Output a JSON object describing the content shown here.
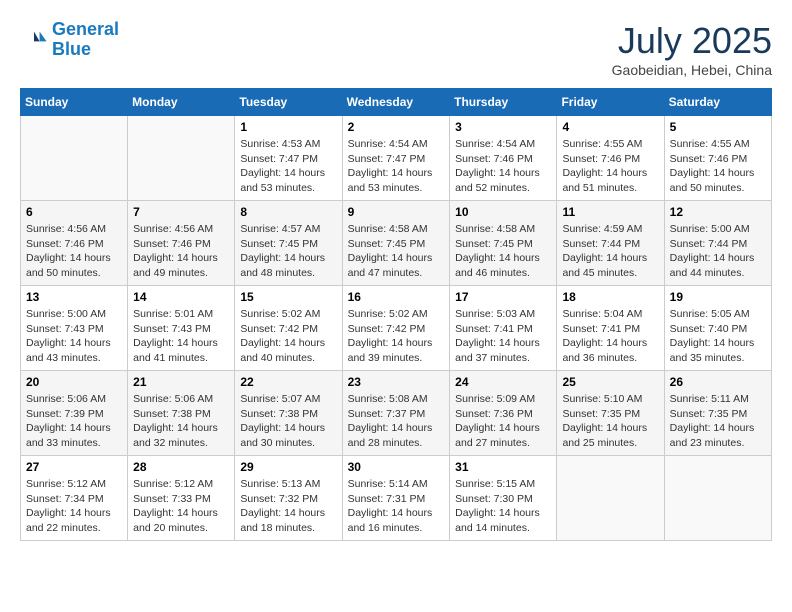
{
  "header": {
    "logo_line1": "General",
    "logo_line2": "Blue",
    "month": "July 2025",
    "location": "Gaobeidian, Hebei, China"
  },
  "days_of_week": [
    "Sunday",
    "Monday",
    "Tuesday",
    "Wednesday",
    "Thursday",
    "Friday",
    "Saturday"
  ],
  "weeks": [
    [
      {
        "num": "",
        "info": ""
      },
      {
        "num": "",
        "info": ""
      },
      {
        "num": "1",
        "info": "Sunrise: 4:53 AM\nSunset: 7:47 PM\nDaylight: 14 hours and 53 minutes."
      },
      {
        "num": "2",
        "info": "Sunrise: 4:54 AM\nSunset: 7:47 PM\nDaylight: 14 hours and 53 minutes."
      },
      {
        "num": "3",
        "info": "Sunrise: 4:54 AM\nSunset: 7:46 PM\nDaylight: 14 hours and 52 minutes."
      },
      {
        "num": "4",
        "info": "Sunrise: 4:55 AM\nSunset: 7:46 PM\nDaylight: 14 hours and 51 minutes."
      },
      {
        "num": "5",
        "info": "Sunrise: 4:55 AM\nSunset: 7:46 PM\nDaylight: 14 hours and 50 minutes."
      }
    ],
    [
      {
        "num": "6",
        "info": "Sunrise: 4:56 AM\nSunset: 7:46 PM\nDaylight: 14 hours and 50 minutes."
      },
      {
        "num": "7",
        "info": "Sunrise: 4:56 AM\nSunset: 7:46 PM\nDaylight: 14 hours and 49 minutes."
      },
      {
        "num": "8",
        "info": "Sunrise: 4:57 AM\nSunset: 7:45 PM\nDaylight: 14 hours and 48 minutes."
      },
      {
        "num": "9",
        "info": "Sunrise: 4:58 AM\nSunset: 7:45 PM\nDaylight: 14 hours and 47 minutes."
      },
      {
        "num": "10",
        "info": "Sunrise: 4:58 AM\nSunset: 7:45 PM\nDaylight: 14 hours and 46 minutes."
      },
      {
        "num": "11",
        "info": "Sunrise: 4:59 AM\nSunset: 7:44 PM\nDaylight: 14 hours and 45 minutes."
      },
      {
        "num": "12",
        "info": "Sunrise: 5:00 AM\nSunset: 7:44 PM\nDaylight: 14 hours and 44 minutes."
      }
    ],
    [
      {
        "num": "13",
        "info": "Sunrise: 5:00 AM\nSunset: 7:43 PM\nDaylight: 14 hours and 43 minutes."
      },
      {
        "num": "14",
        "info": "Sunrise: 5:01 AM\nSunset: 7:43 PM\nDaylight: 14 hours and 41 minutes."
      },
      {
        "num": "15",
        "info": "Sunrise: 5:02 AM\nSunset: 7:42 PM\nDaylight: 14 hours and 40 minutes."
      },
      {
        "num": "16",
        "info": "Sunrise: 5:02 AM\nSunset: 7:42 PM\nDaylight: 14 hours and 39 minutes."
      },
      {
        "num": "17",
        "info": "Sunrise: 5:03 AM\nSunset: 7:41 PM\nDaylight: 14 hours and 37 minutes."
      },
      {
        "num": "18",
        "info": "Sunrise: 5:04 AM\nSunset: 7:41 PM\nDaylight: 14 hours and 36 minutes."
      },
      {
        "num": "19",
        "info": "Sunrise: 5:05 AM\nSunset: 7:40 PM\nDaylight: 14 hours and 35 minutes."
      }
    ],
    [
      {
        "num": "20",
        "info": "Sunrise: 5:06 AM\nSunset: 7:39 PM\nDaylight: 14 hours and 33 minutes."
      },
      {
        "num": "21",
        "info": "Sunrise: 5:06 AM\nSunset: 7:38 PM\nDaylight: 14 hours and 32 minutes."
      },
      {
        "num": "22",
        "info": "Sunrise: 5:07 AM\nSunset: 7:38 PM\nDaylight: 14 hours and 30 minutes."
      },
      {
        "num": "23",
        "info": "Sunrise: 5:08 AM\nSunset: 7:37 PM\nDaylight: 14 hours and 28 minutes."
      },
      {
        "num": "24",
        "info": "Sunrise: 5:09 AM\nSunset: 7:36 PM\nDaylight: 14 hours and 27 minutes."
      },
      {
        "num": "25",
        "info": "Sunrise: 5:10 AM\nSunset: 7:35 PM\nDaylight: 14 hours and 25 minutes."
      },
      {
        "num": "26",
        "info": "Sunrise: 5:11 AM\nSunset: 7:35 PM\nDaylight: 14 hours and 23 minutes."
      }
    ],
    [
      {
        "num": "27",
        "info": "Sunrise: 5:12 AM\nSunset: 7:34 PM\nDaylight: 14 hours and 22 minutes."
      },
      {
        "num": "28",
        "info": "Sunrise: 5:12 AM\nSunset: 7:33 PM\nDaylight: 14 hours and 20 minutes."
      },
      {
        "num": "29",
        "info": "Sunrise: 5:13 AM\nSunset: 7:32 PM\nDaylight: 14 hours and 18 minutes."
      },
      {
        "num": "30",
        "info": "Sunrise: 5:14 AM\nSunset: 7:31 PM\nDaylight: 14 hours and 16 minutes."
      },
      {
        "num": "31",
        "info": "Sunrise: 5:15 AM\nSunset: 7:30 PM\nDaylight: 14 hours and 14 minutes."
      },
      {
        "num": "",
        "info": ""
      },
      {
        "num": "",
        "info": ""
      }
    ]
  ]
}
